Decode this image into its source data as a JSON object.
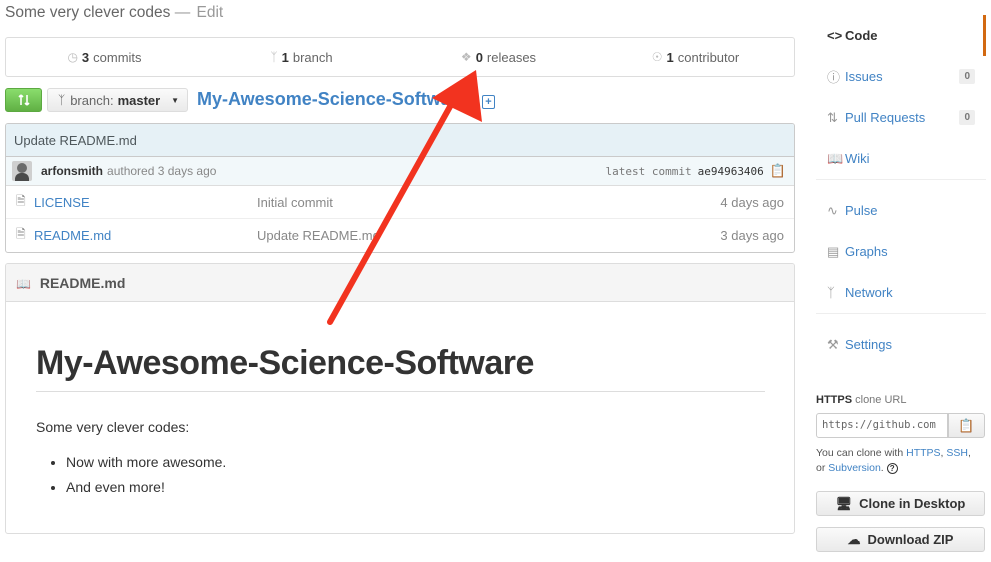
{
  "description": {
    "text": "Some very clever codes",
    "separator": "—",
    "edit": "Edit"
  },
  "summary": {
    "commits": {
      "count": "3",
      "label": "commits",
      "icon": "history-icon"
    },
    "branches": {
      "count": "1",
      "label": "branch",
      "icon": "branch-icon"
    },
    "releases": {
      "count": "0",
      "label": "releases",
      "icon": "tag-icon"
    },
    "contributors": {
      "count": "1",
      "label": "contributor",
      "icon": "organization-icon"
    }
  },
  "toolbar": {
    "compare_icon": "compare-icon",
    "branch_prefix": "branch:",
    "branch_value": "master",
    "repo_name": "My-Awesome-Science-Software",
    "add_file": "+"
  },
  "commit": {
    "message": "Update README.md",
    "author": "arfonsmith",
    "authored": "authored 3 days ago",
    "latest_label": "latest commit",
    "sha": "ae94963406"
  },
  "files": [
    {
      "name": "LICENSE",
      "message": "Initial commit",
      "age": "4 days ago"
    },
    {
      "name": "README.md",
      "message": "Update README.md",
      "age": "3 days ago"
    }
  ],
  "readme": {
    "filename": "README.md",
    "heading": "My-Awesome-Science-Software",
    "paragraph": "Some very clever codes:",
    "list": [
      "Now with more awesome.",
      "And even more!"
    ]
  },
  "nav": {
    "code": "Code",
    "issues": {
      "label": "Issues",
      "count": "0"
    },
    "pull_requests": {
      "label": "Pull Requests",
      "count": "0"
    },
    "wiki": "Wiki",
    "pulse": "Pulse",
    "graphs": "Graphs",
    "network": "Network",
    "settings": "Settings"
  },
  "clone": {
    "protocol": "HTTPS",
    "label_suffix": "clone URL",
    "url": "https://github.com",
    "help_prefix": "You can clone with",
    "https": "HTTPS",
    "ssh": "SSH",
    "or": "or",
    "subversion": "Subversion",
    "help_icon": "?",
    "desktop_button": "Clone in Desktop",
    "zip_button": "Download ZIP"
  },
  "colors": {
    "link": "#4183c4",
    "accent_selected": "#d26911",
    "compare_green": "#60b044",
    "annotation_arrow": "#f2331f"
  }
}
